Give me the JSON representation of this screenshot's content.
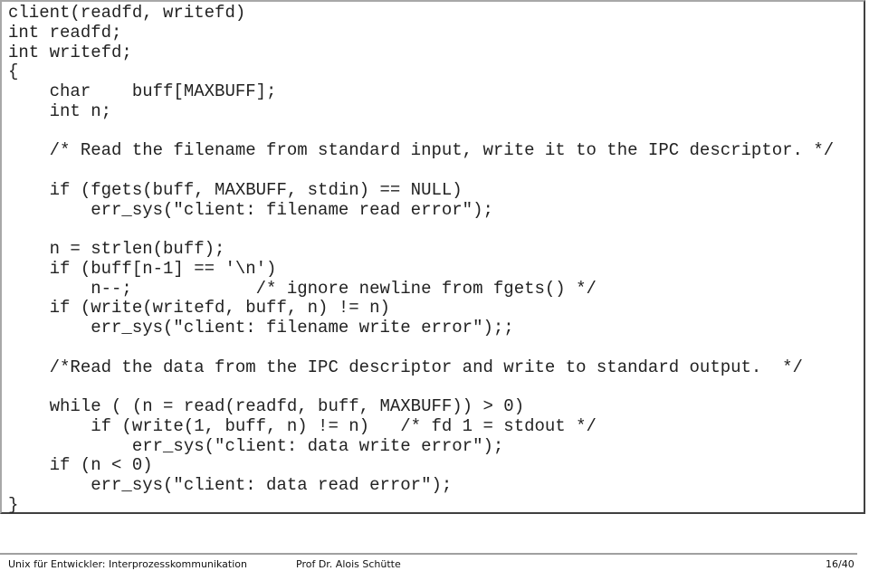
{
  "code_lines": [
    "client(readfd, writefd)",
    "int readfd;",
    "int writefd;",
    "{",
    "    char    buff[MAXBUFF];",
    "    int n;",
    "",
    "    /* Read the filename from standard input, write it to the IPC descriptor. */",
    "",
    "    if (fgets(buff, MAXBUFF, stdin) == NULL)",
    "        err_sys(\"client: filename read error\");",
    "",
    "    n = strlen(buff);",
    "    if (buff[n-1] == '\\n')",
    "        n--;            /* ignore newline from fgets() */",
    "    if (write(writefd, buff, n) != n)",
    "        err_sys(\"client: filename write error\");;",
    "",
    "    /*Read the data from the IPC descriptor and write to standard output.  */",
    "",
    "    while ( (n = read(readfd, buff, MAXBUFF)) > 0)",
    "        if (write(1, buff, n) != n)   /* fd 1 = stdout */",
    "            err_sys(\"client: data write error\");",
    "    if (n < 0)",
    "        err_sys(\"client: data read error\");",
    "}"
  ],
  "footer": {
    "course": "Unix für Entwickler: Interprozesskommunikation",
    "author": "Prof Dr. Alois Schütte",
    "page": "16/40"
  }
}
